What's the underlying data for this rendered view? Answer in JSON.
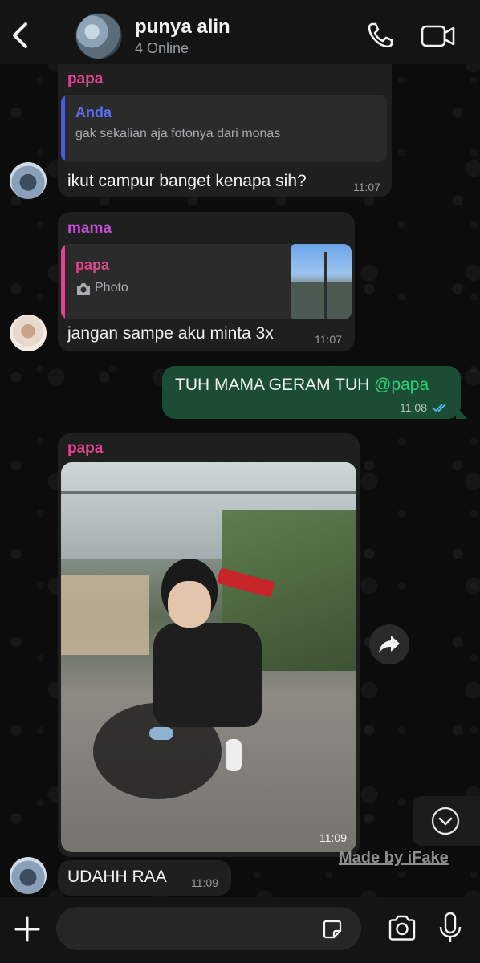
{
  "header": {
    "title": "punya alin",
    "subtitle": "4 Online"
  },
  "messages": [
    {
      "sender": "papa",
      "sender_color": "#e0468f",
      "quote": {
        "name": "Anda",
        "name_color": "#5d6df0",
        "text": "gak sekalian aja fotonya dari monas",
        "bar_color": "#4a5ae0"
      },
      "text": "ikut campur banget kenapa sih?",
      "time": "11:07"
    },
    {
      "sender": "mama",
      "sender_color": "#c24fd6",
      "quote": {
        "name": "papa",
        "name_color": "#e0468f",
        "text": "Photo",
        "bar_color": "#e0468f"
      },
      "text": "jangan sampe aku minta 3x",
      "time": "11:07"
    },
    {
      "outgoing": true,
      "text": "TUH MAMA GERAM TUH ",
      "mention": "@papa",
      "mention_color": "#2fd07a",
      "time": "11:08",
      "status": "read"
    },
    {
      "sender": "papa",
      "sender_color": "#e0468f",
      "photo": true,
      "time": "11:09"
    },
    {
      "text": "UDAHH RAA",
      "time": "11:09"
    }
  ],
  "watermark": "Made by iFake",
  "input": {
    "placeholder": ""
  },
  "icons": {
    "back": "chevron-left-icon",
    "call": "phone-icon",
    "video": "video-camera-icon",
    "forward": "forward-arrow-icon",
    "scroll_down": "chevron-down-circle-icon",
    "plus": "plus-icon",
    "sticker": "sticker-icon",
    "camera": "camera-icon",
    "mic": "microphone-icon"
  }
}
